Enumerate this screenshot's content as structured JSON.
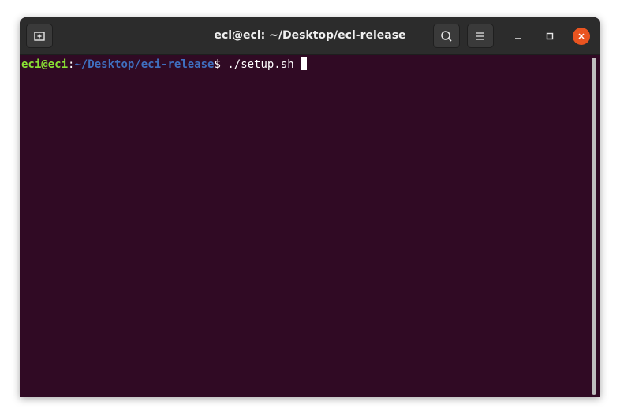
{
  "window": {
    "title": "eci@eci: ~/Desktop/eci-release"
  },
  "header_buttons": {
    "new_tab_icon": "new-tab-icon",
    "search_icon": "search-icon",
    "menu_icon": "hamburger-menu-icon"
  },
  "window_controls": {
    "minimize_icon": "minimize-icon",
    "maximize_icon": "maximize-icon",
    "close_icon": "close-icon"
  },
  "terminal": {
    "prompt_user": "eci@eci",
    "prompt_colon": ":",
    "prompt_path": "~/Desktop/eci-release",
    "prompt_symbol": "$",
    "command": " ./setup.sh "
  },
  "colors": {
    "terminal_bg": "#300a24",
    "titlebar_bg": "#2c2c2c",
    "prompt_user": "#8ae234",
    "prompt_path": "#3f6fbf",
    "close_button": "#e95420"
  }
}
